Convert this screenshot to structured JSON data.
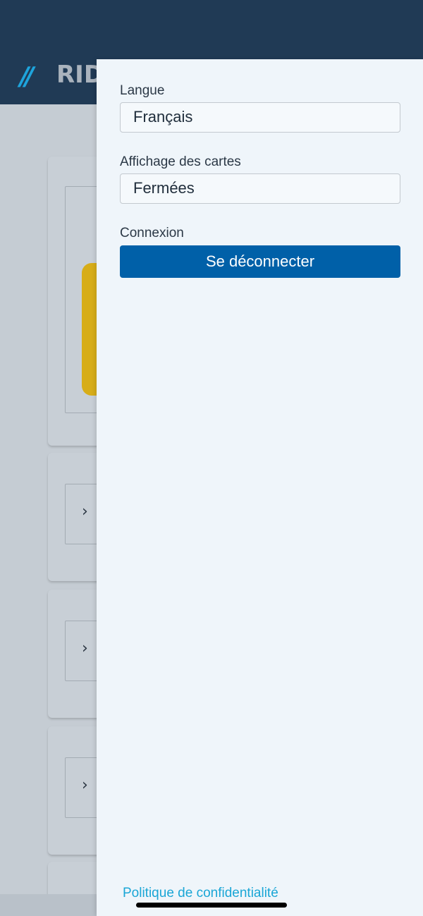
{
  "app": {
    "logo_slashes": "//",
    "logo_text_visible": "RID"
  },
  "settings_panel": {
    "language": {
      "label": "Langue",
      "value": "Français"
    },
    "card_display": {
      "label": "Affichage des cartes",
      "value": "Fermées"
    },
    "connection": {
      "label": "Connexion",
      "logout_button": "Se déconnecter"
    },
    "privacy_link": "Politique de confidentialité"
  },
  "background": {
    "chevron_glyph": "›"
  },
  "colors": {
    "header_bg": "#203a55",
    "accent_blue": "#0060a8",
    "link_color": "#1aa6d6",
    "logo_accent": "#1ea4dc",
    "yellow_card": "#d7ad18"
  }
}
